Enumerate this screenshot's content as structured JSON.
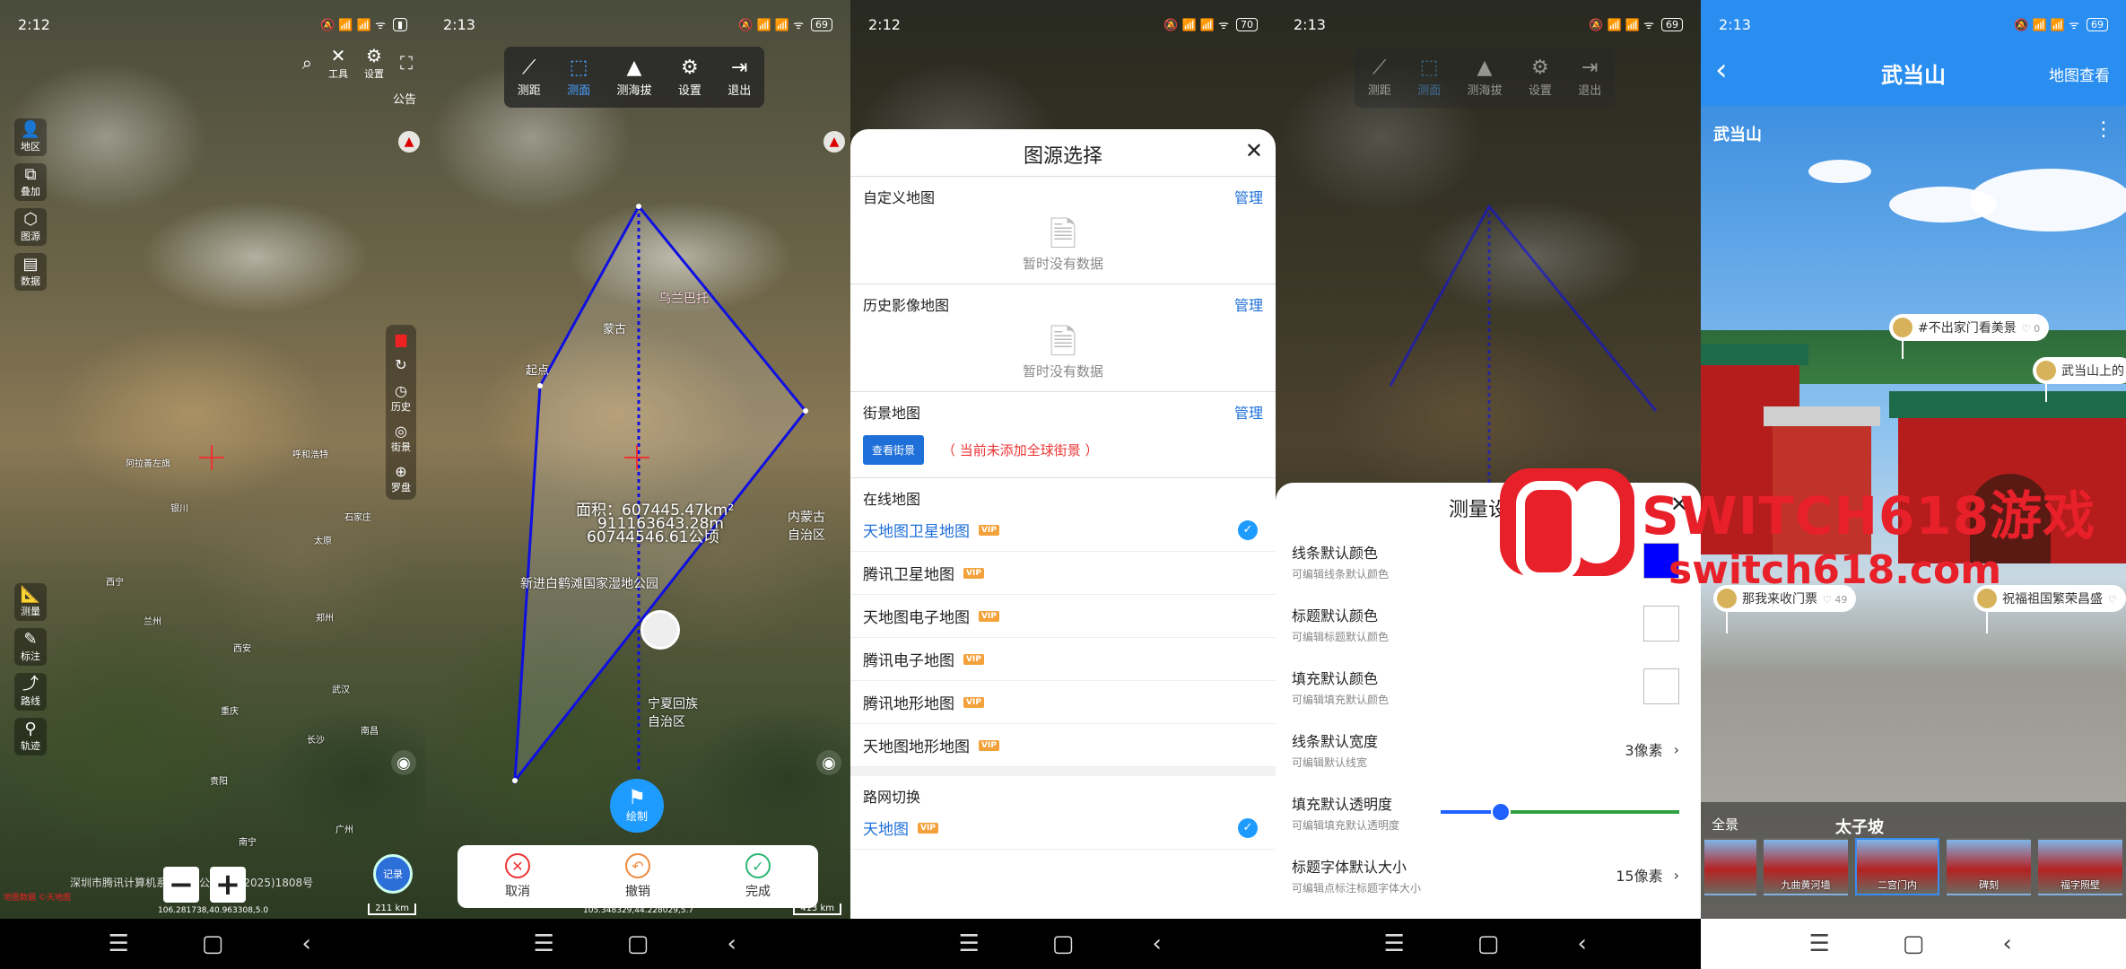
{
  "panel1": {
    "time": "2:12",
    "battery": "",
    "top_icons": [
      {
        "icon": "search-icon",
        "label": ""
      },
      {
        "icon": "tools-icon",
        "label": "工具"
      },
      {
        "icon": "gear-icon",
        "label": "设置"
      },
      {
        "icon": "fullscreen-icon",
        "label": ""
      }
    ],
    "notice": "公告",
    "left_tools_top": [
      {
        "icon": "region-icon",
        "label": "地区"
      },
      {
        "icon": "overlay-icon",
        "label": "叠加"
      },
      {
        "icon": "layers-icon",
        "label": "图源"
      },
      {
        "icon": "data-icon",
        "label": "数据"
      }
    ],
    "right_tools": [
      {
        "icon": "red-stamp-icon",
        "label": ""
      },
      {
        "icon": "compass-3d-icon",
        "label": ""
      },
      {
        "icon": "history-icon",
        "label": "历史"
      },
      {
        "icon": "streetview-icon",
        "label": "街景"
      },
      {
        "icon": "compass-icon",
        "label": "罗盘"
      }
    ],
    "left_tools_bottom": [
      {
        "icon": "ruler-icon",
        "label": "测量"
      },
      {
        "icon": "marker-icon",
        "label": "标注"
      },
      {
        "icon": "route-icon",
        "label": "路线"
      },
      {
        "icon": "track-icon",
        "label": "轨迹"
      }
    ],
    "map_labels": [
      "阿拉善左旗",
      "银川",
      "石家庄",
      "太原",
      "呼和浩特",
      "西宁",
      "兰州",
      "郑州",
      "西安",
      "武汉",
      "重庆",
      "贵阳",
      "南昌",
      "长沙",
      "广州",
      "南宁"
    ],
    "copyright": "深圳市腾讯计算机系统有限公司 GS(2025)1808号",
    "redtext": "地图数据 ©天地图",
    "coords": "106.281738,40.963308,5.0",
    "scale": "211 km",
    "zoom_minus": "−",
    "zoom_plus": "+",
    "avatar_label": "记录"
  },
  "panel2": {
    "time": "2:13",
    "battery": "69",
    "toolbar": [
      {
        "icon": "distance-icon",
        "label": "测距",
        "active": false
      },
      {
        "icon": "area-icon",
        "label": "测面",
        "active": true
      },
      {
        "icon": "altitude-icon",
        "label": "测海拔",
        "active": false
      },
      {
        "icon": "gear-icon",
        "label": "设置",
        "active": false
      },
      {
        "icon": "exit-icon",
        "label": "退出",
        "active": false
      }
    ],
    "start_label": "起点",
    "region1": "蒙古",
    "region2": "内蒙古\n自治区",
    "region3": "宁夏回族\n自治区",
    "region4": "新进白鹤滩国家湿地公园",
    "region5": "乌兰巴托",
    "area_line1": "面积：607445.47km²",
    "area_line2": "911163643.28m",
    "area_line3": "60744546.61公顷",
    "draw_label": "绘制",
    "actions": [
      {
        "icon": "cancel-icon",
        "label": "取消"
      },
      {
        "icon": "undo-icon",
        "label": "撤销"
      },
      {
        "icon": "done-icon",
        "label": "完成"
      }
    ],
    "coords": "105.348329,44.228029,5.7",
    "scale": "413 km"
  },
  "panel3": {
    "time": "2:12",
    "battery": "70",
    "title": "图源选择",
    "sections": [
      {
        "title": "自定义地图",
        "manage": "管理",
        "empty": "暂时没有数据"
      },
      {
        "title": "历史影像地图",
        "manage": "管理",
        "empty": "暂时没有数据"
      }
    ],
    "street": {
      "title": "街景地图",
      "manage": "管理",
      "button": "查看街景",
      "note": "（ 当前未添加全球街景 ）"
    },
    "online_title": "在线地图",
    "online_maps": [
      {
        "label": "天地图卫星地图",
        "vip": "VIP",
        "selected": true
      },
      {
        "label": "腾讯卫星地图",
        "vip": "VIP",
        "selected": false
      },
      {
        "label": "天地图电子地图",
        "vip": "VIP",
        "selected": false
      },
      {
        "label": "腾讯电子地图",
        "vip": "VIP",
        "selected": false
      },
      {
        "label": "腾讯地形地图",
        "vip": "VIP",
        "selected": false
      },
      {
        "label": "天地图地形地图",
        "vip": "VIP",
        "selected": false
      }
    ],
    "road_title": "路网切换",
    "road_maps": [
      {
        "label": "天地图",
        "vip": "VIP",
        "selected": true
      }
    ]
  },
  "panel4": {
    "time": "2:13",
    "battery": "69",
    "title": "测量设置",
    "rows": [
      {
        "label": "线条默认颜色",
        "desc": "可编辑线条默认颜色",
        "kind": "swatch",
        "color": "#0000ff"
      },
      {
        "label": "标题默认颜色",
        "desc": "可编辑标题默认颜色",
        "kind": "swatch",
        "color": "#ffffff"
      },
      {
        "label": "填充默认颜色",
        "desc": "可编辑填充默认颜色",
        "kind": "swatch",
        "color": "#ffffff"
      },
      {
        "label": "线条默认宽度",
        "desc": "可编辑默认线宽",
        "kind": "value",
        "value": "3像素"
      },
      {
        "label": "填充默认透明度",
        "desc": "可编辑填充默认透明度",
        "kind": "slider",
        "level": 0.25
      },
      {
        "label": "标题字体默认大小",
        "desc": "可编辑点标注标题字体大小",
        "kind": "value",
        "value": "15像素"
      }
    ],
    "watermark_line1": "SWITCH618游戏",
    "watermark_line2": "switch618.com"
  },
  "panel5": {
    "time": "2:13",
    "battery": "69",
    "header_title": "武当山",
    "header_right": "地图查看",
    "pano_title": "武当山",
    "bubbles": [
      {
        "text": "#不出家门看美景",
        "likes": "0"
      },
      {
        "text": "武当山上的",
        "likes": ""
      },
      {
        "text": "那我来收门票",
        "likes": "49"
      },
      {
        "text": "祝福祖国繁荣昌盛",
        "likes": ""
      }
    ],
    "category_left": "全景",
    "category": "太子坡",
    "thumbnails": [
      {
        "label": "",
        "selected": false
      },
      {
        "label": "九曲黄河墙",
        "selected": false
      },
      {
        "label": "二宫门内",
        "selected": true
      },
      {
        "label": "碑刻",
        "selected": false
      },
      {
        "label": "福字照壁",
        "selected": false
      }
    ]
  },
  "nav": {
    "menu": "☰",
    "home": "▢",
    "back": "‹"
  }
}
